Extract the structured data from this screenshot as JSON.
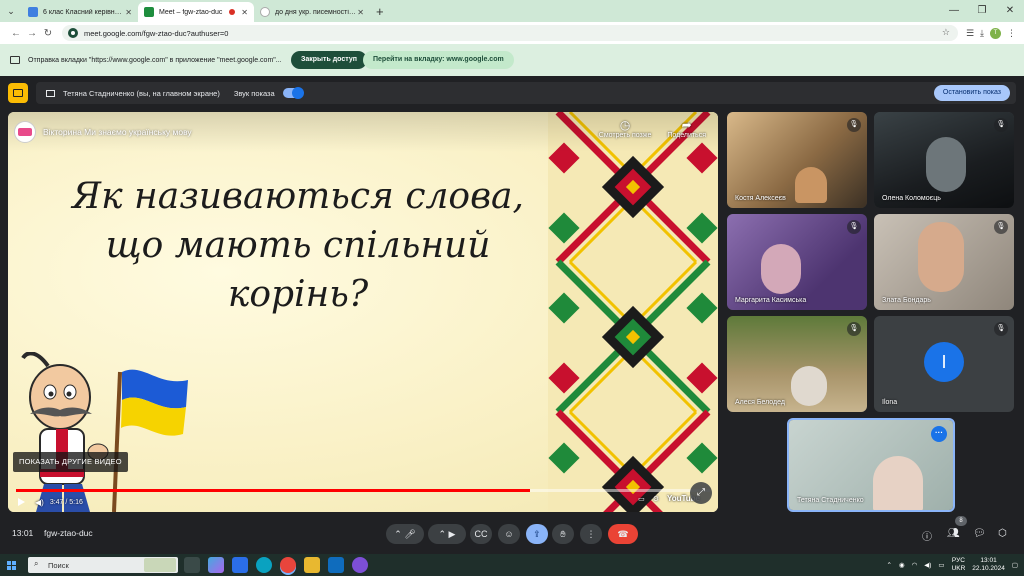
{
  "browser": {
    "tabs": [
      {
        "title": "6 клас Класний керівник: Кузь",
        "color": "#3f7fe0",
        "active": false
      },
      {
        "title": "Meet – fgw-ztao-duc",
        "color": "#1e8e3e",
        "active": true,
        "recording": true
      },
      {
        "title": "до дня укр. писемності та",
        "color": "#7a7a7a",
        "active": false
      }
    ],
    "new_tab": "+",
    "url": "meet.google.com/fgw-ztao-duc?authuser=0",
    "profile_initial": "Т"
  },
  "infobar": {
    "message": "Отправка вкладки \"https://www.google.com\" в приложение \"meet.google.com\"...",
    "close_access": "Закрыть доступ",
    "go_to_tab": "Перейти на вкладку: www.google.com"
  },
  "presenting": {
    "label": "Тетяна Стадниченко (вы, на главном экране)",
    "sound_label": "Звук показа",
    "stop_button": "Остановить показ"
  },
  "video": {
    "title": "Вікторина Ми знаємо українську мову",
    "watch_later": "Смотреть позже",
    "share": "Поделиться",
    "question_lines": [
      "Як називаються слова,",
      "що мають спільний",
      "корінь?"
    ],
    "more_videos": "ПОКАЗАТЬ ДРУГИЕ ВИДЕО",
    "time": "3:47 / 5:16",
    "progress": 0.74,
    "logo": "YouTube"
  },
  "participants": [
    {
      "name": "Костя Алексеєв",
      "bg": "#b89a6a"
    },
    {
      "name": "Олена Коломоєць",
      "bg": "#2b2f33"
    },
    {
      "name": "Маргарита Касимська",
      "bg": "#6a4e86"
    },
    {
      "name": "Злата Бондарь",
      "bg": "#a89f95"
    },
    {
      "name": "Алеся Белодед",
      "bg": "#7d8e5b"
    },
    {
      "name": "Ilona",
      "bg": "#3c4043",
      "initial": "I"
    },
    {
      "name": "Тетяна Стадниченко",
      "bg": "#b9c6c3"
    }
  ],
  "meetbar": {
    "time": "13:01",
    "code": "fgw-ztao-duc",
    "people_count": "8"
  },
  "taskbar": {
    "search_placeholder": "Поиск",
    "lang_top": "РУС",
    "lang_bottom": "UKR",
    "clock_time": "13:01",
    "clock_date": "22.10.2024"
  }
}
